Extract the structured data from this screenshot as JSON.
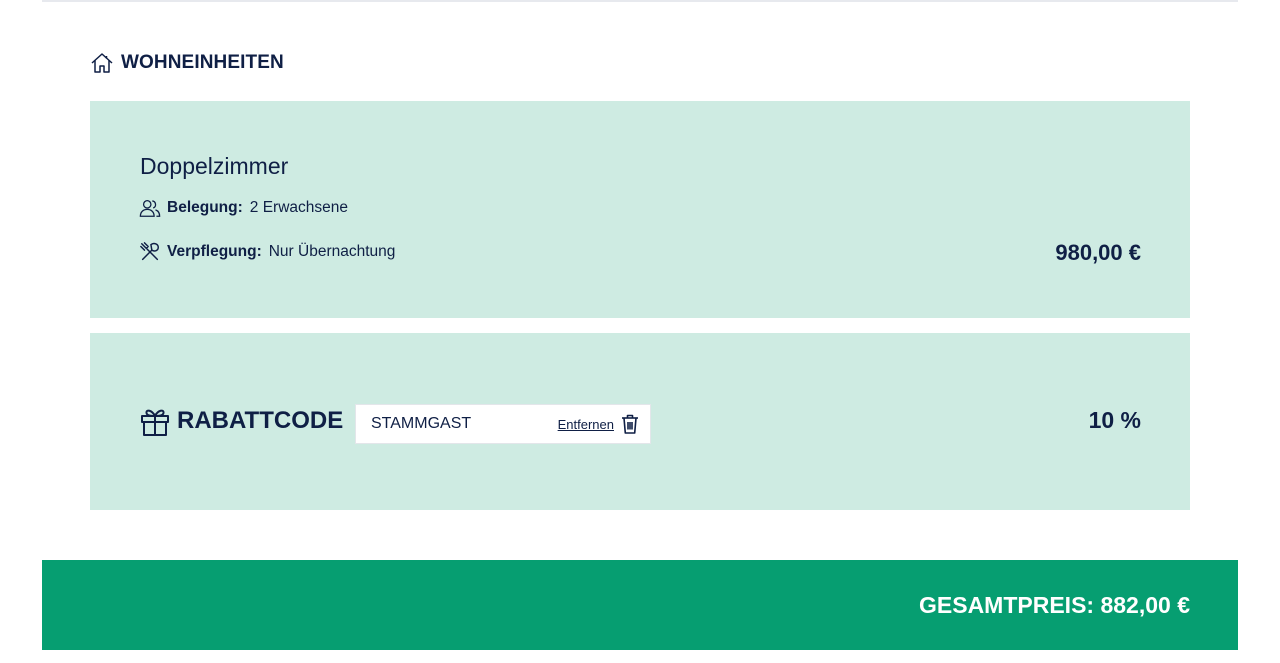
{
  "section": {
    "icon": "house-icon",
    "title": "WOHNEINHEITEN"
  },
  "room": {
    "name": "Doppelzimmer",
    "occupancy": {
      "icon": "people-icon",
      "label": "Belegung:",
      "value": "2 Erwachsene"
    },
    "board": {
      "icon": "utensils-icon",
      "label": "Verpflegung:",
      "value": "Nur Übernachtung"
    },
    "price": "980,00 €"
  },
  "discount": {
    "icon": "gift-icon",
    "title": "RABATTCODE",
    "code": "STAMMGAST",
    "remove_label": "Entfernen",
    "remove_icon": "trash-icon",
    "value": "10 %"
  },
  "total": {
    "text": "GESAMTPREIS: 882,00 €"
  },
  "colors": {
    "card_bg": "#ceebe2",
    "total_bg": "#069e71",
    "text": "#0f1f45"
  }
}
